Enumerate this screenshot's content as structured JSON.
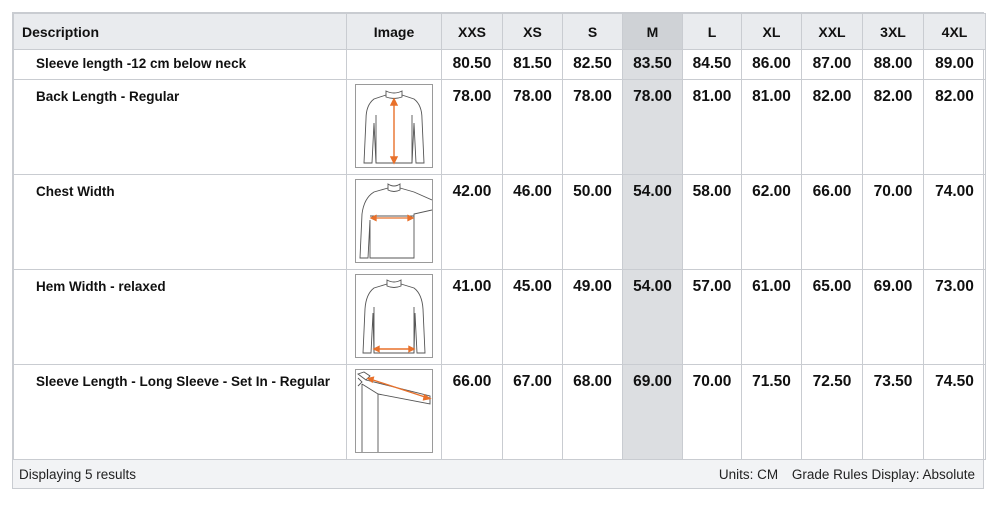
{
  "columns": {
    "description": "Description",
    "image": "Image",
    "sizes": [
      "XXS",
      "XS",
      "S",
      "M",
      "L",
      "XL",
      "XXL",
      "3XL",
      "4XL"
    ],
    "highlighted_size": "M"
  },
  "rows": [
    {
      "description": "Sleeve length -12 cm below neck",
      "image": "",
      "values": [
        "80.50",
        "81.50",
        "82.50",
        "83.50",
        "84.50",
        "86.00",
        "87.00",
        "88.00",
        "89.00"
      ]
    },
    {
      "description": "Back Length - Regular",
      "image": "back-length-diagram",
      "values": [
        "78.00",
        "78.00",
        "78.00",
        "78.00",
        "81.00",
        "81.00",
        "82.00",
        "82.00",
        "82.00"
      ]
    },
    {
      "description": "Chest Width",
      "image": "chest-width-diagram",
      "values": [
        "42.00",
        "46.00",
        "50.00",
        "54.00",
        "58.00",
        "62.00",
        "66.00",
        "70.00",
        "74.00"
      ]
    },
    {
      "description": "Hem Width - relaxed",
      "image": "hem-width-diagram",
      "values": [
        "41.00",
        "45.00",
        "49.00",
        "54.00",
        "57.00",
        "61.00",
        "65.00",
        "69.00",
        "73.00"
      ]
    },
    {
      "description": "Sleeve Length - Long Sleeve - Set In - Regular",
      "image": "sleeve-length-diagram",
      "values": [
        "66.00",
        "67.00",
        "68.00",
        "69.00",
        "70.00",
        "71.50",
        "72.50",
        "73.50",
        "74.50"
      ]
    }
  ],
  "footer": {
    "results": "Displaying 5 results",
    "units": "Units: CM",
    "grade_rules": "Grade Rules Display: Absolute"
  },
  "colors": {
    "header_bg": "#e9ebee",
    "highlight_column": "#dcdee1",
    "measure_arrow": "#e8702a",
    "border": "#c9ccd1"
  }
}
